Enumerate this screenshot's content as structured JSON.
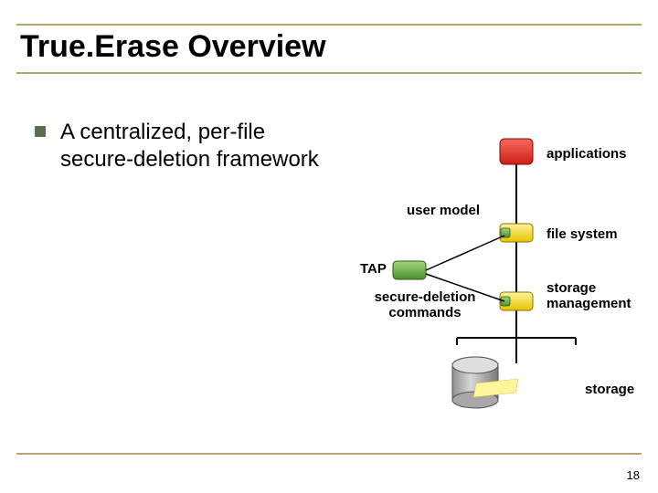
{
  "title": "True.Erase Overview",
  "bullet": "A centralized, per-file secure-deletion framework",
  "labels": {
    "applications": "applications",
    "user_model": "user model",
    "file_system": "file system",
    "tap": "TAP",
    "secure_deletion_commands": "secure-deletion commands",
    "storage_management": "storage management",
    "storage": "storage"
  },
  "page_number": "18",
  "colors": {
    "accent_rule": "#b8a274",
    "bullet_square": "#5e6e4d",
    "app_box": "#e7342a",
    "fs_box": "#f9e24b",
    "sm_box": "#f9e24b",
    "tap_box": "#6fae4b",
    "storage_cyl": "#b8b8b8"
  }
}
